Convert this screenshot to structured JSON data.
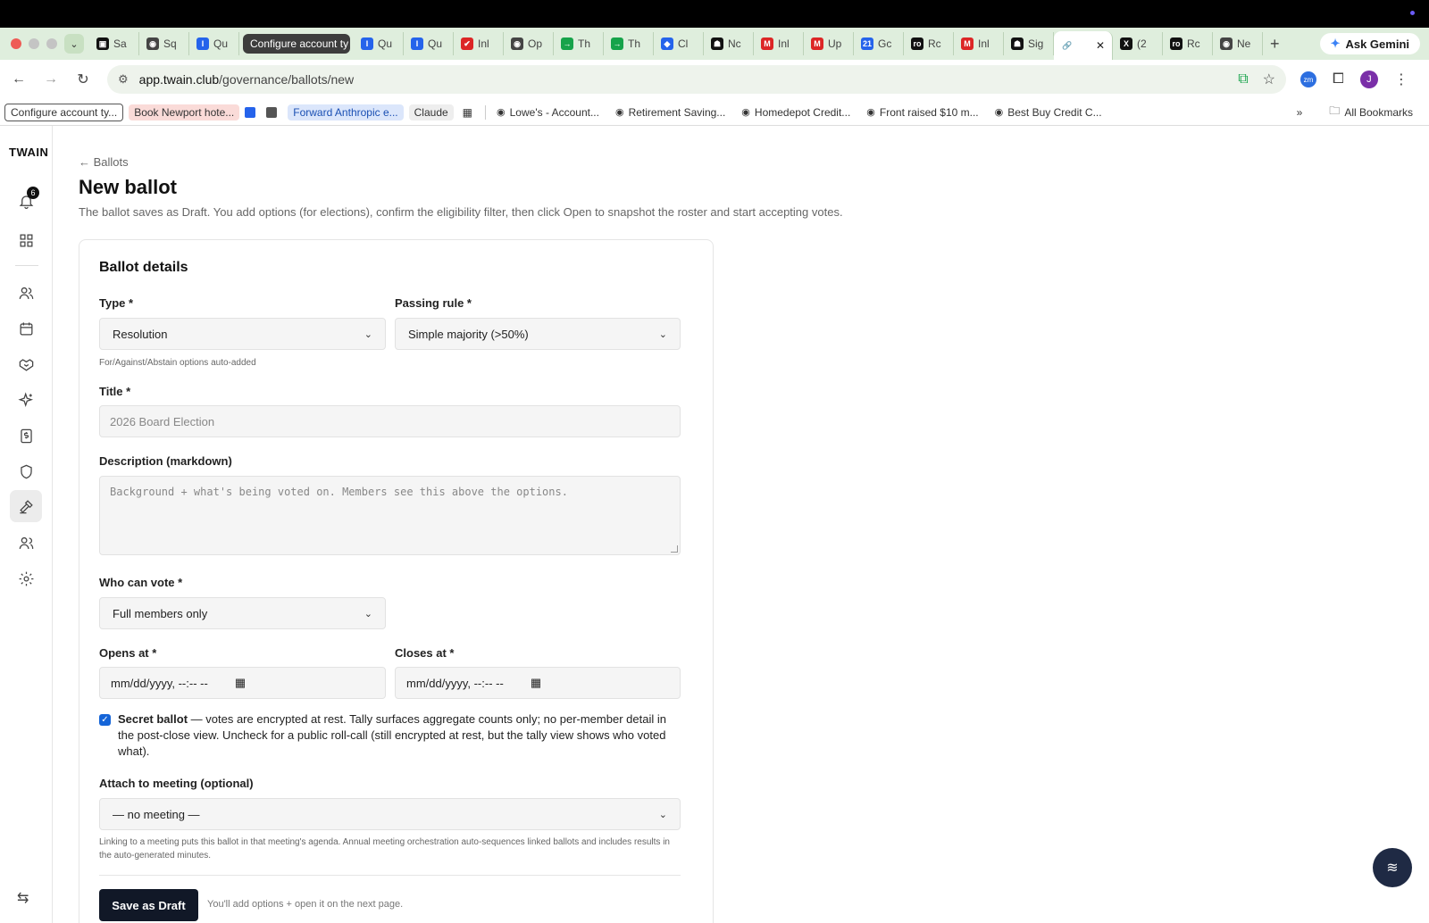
{
  "browser": {
    "tabs": [
      {
        "title": "Sa",
        "fav": "▣",
        "color": "#111"
      },
      {
        "title": "Sq",
        "fav": "◉",
        "color": "#444"
      },
      {
        "title": "Qu",
        "fav": "I",
        "color": "#2563eb"
      },
      {
        "title": "Configure account ty",
        "fav": "",
        "color": "#3d3d3d",
        "group": true
      },
      {
        "title": "Qu",
        "fav": "I",
        "color": "#2563eb"
      },
      {
        "title": "Qu",
        "fav": "I",
        "color": "#2563eb"
      },
      {
        "title": "Inl",
        "fav": "✔",
        "color": "#dc2626"
      },
      {
        "title": "Op",
        "fav": "◉",
        "color": "#444"
      },
      {
        "title": "Th",
        "fav": "→",
        "color": "#16a34a"
      },
      {
        "title": "Th",
        "fav": "→",
        "color": "#16a34a"
      },
      {
        "title": "Cl",
        "fav": "◆",
        "color": "#2563eb"
      },
      {
        "title": "Nc",
        "fav": "☗",
        "color": "#111"
      },
      {
        "title": "Inl",
        "fav": "M",
        "color": "#dc2626"
      },
      {
        "title": "Up",
        "fav": "M",
        "color": "#dc2626"
      },
      {
        "title": "Gc",
        "fav": "21",
        "color": "#2563eb"
      },
      {
        "title": "Rc",
        "fav": "ro",
        "color": "#111"
      },
      {
        "title": "Inl",
        "fav": "M",
        "color": "#dc2626"
      },
      {
        "title": "Sig",
        "fav": "☗",
        "color": "#111"
      },
      {
        "title": "",
        "fav": "🔗",
        "color": "#fff",
        "active": true
      },
      {
        "title": "(2",
        "fav": "X",
        "color": "#111"
      },
      {
        "title": "Rc",
        "fav": "ro",
        "color": "#111"
      },
      {
        "title": "Ne",
        "fav": "◉",
        "color": "#444"
      }
    ],
    "gemini_label": "Ask Gemini",
    "url_host": "app.twain.club",
    "url_path": "/governance/ballots/new",
    "profile_initial": "J",
    "bookmarks": [
      {
        "label": "Configure account ty...",
        "style": "boxed"
      },
      {
        "label": "Book Newport hote...",
        "style": "pink"
      },
      {
        "label": "",
        "style": "sq-blue"
      },
      {
        "label": "",
        "style": "sq-grey"
      },
      {
        "label": "Forward Anthropic e...",
        "style": "blue"
      },
      {
        "label": "Claude",
        "style": "grey"
      },
      {
        "label": "Lowe's - Account...",
        "style": "plain"
      },
      {
        "label": "Retirement Saving...",
        "style": "plain"
      },
      {
        "label": "Homedepot Credit...",
        "style": "plain"
      },
      {
        "label": "Front raised $10 m...",
        "style": "plain"
      },
      {
        "label": "Best Buy Credit C...",
        "style": "plain"
      }
    ],
    "all_bookmarks_label": "All Bookmarks"
  },
  "app": {
    "logo": "TWAIN",
    "notification_count": "6",
    "nav_icons": [
      "bell-icon",
      "dashboard-icon",
      "members-icon",
      "calendar-icon",
      "handshake-icon",
      "sparkle-icon",
      "billing-icon",
      "shield-icon",
      "gavel-icon",
      "users-icon",
      "settings-icon"
    ]
  },
  "page": {
    "back_label": "← Ballots",
    "title": "New ballot",
    "subtitle": "The ballot saves as Draft. You add options (for elections), confirm the eligibility filter, then click Open to snapshot the roster and start accepting votes.",
    "card_title": "Ballot details",
    "type": {
      "label": "Type *",
      "value": "Resolution",
      "hint": "For/Against/Abstain options auto-added"
    },
    "passing_rule": {
      "label": "Passing rule *",
      "value": "Simple majority (>50%)"
    },
    "title_field": {
      "label": "Title *",
      "placeholder": "2026 Board Election"
    },
    "description": {
      "label": "Description (markdown)",
      "placeholder": "Background + what's being voted on. Members see this above the options."
    },
    "who_can_vote": {
      "label": "Who can vote *",
      "value": "Full members only"
    },
    "opens_at": {
      "label": "Opens at *",
      "value": "mm/dd/yyyy, --:-- --"
    },
    "closes_at": {
      "label": "Closes at *",
      "value": "mm/dd/yyyy, --:-- --"
    },
    "secret_ballot": {
      "checked": true,
      "label": "Secret ballot",
      "text": " — votes are encrypted at rest. Tally surfaces aggregate counts only; no per-member detail in the post-close view. Uncheck for a public roll-call (still encrypted at rest, but the tally view shows who voted what)."
    },
    "meeting": {
      "label": "Attach to meeting (optional)",
      "value": "— no meeting —",
      "hint": "Linking to a meeting puts this ballot in that meeting's agenda. Annual meeting orchestration auto-sequences linked ballots and includes results in the auto-generated minutes."
    },
    "save_label": "Save as Draft",
    "after_note": "You'll add options + open it on the next page."
  }
}
